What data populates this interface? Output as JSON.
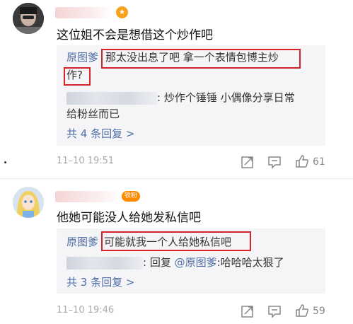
{
  "comments": [
    {
      "level_badge": "★",
      "text": "这位姐不会是想借这个炒作吧",
      "reply1": {
        "author": "原图爹",
        "line1": "那太没出息了吧  拿一个表情包博主炒",
        "line2": "作?"
      },
      "reply2": {
        "line1": ": 炒作个锤锤 小偶像分享日常",
        "line2": "给粉丝而已"
      },
      "more_replies": "共 4 条回复 >",
      "time": "11–10 19:51",
      "likes": "61"
    },
    {
      "fan_badge": "铁粉",
      "text": "他她可能没人给她发私信吧",
      "reply1": {
        "author": "原图爹",
        "text": "可能就我一个人给她私信吧"
      },
      "reply2": {
        "prefix": ": 回复 ",
        "mention": "@原图爹",
        "suffix": ":哈哈哈太狠了"
      },
      "more_replies": "共 3 条回复 >",
      "time": "11–10 19:46",
      "likes": "59"
    }
  ],
  "colors": {
    "highlight_box": "#d8222b",
    "link": "#4f6fa8",
    "reply_bg": "#f5f5f7"
  },
  "icons": [
    "share-icon",
    "comment-icon",
    "like-icon"
  ]
}
